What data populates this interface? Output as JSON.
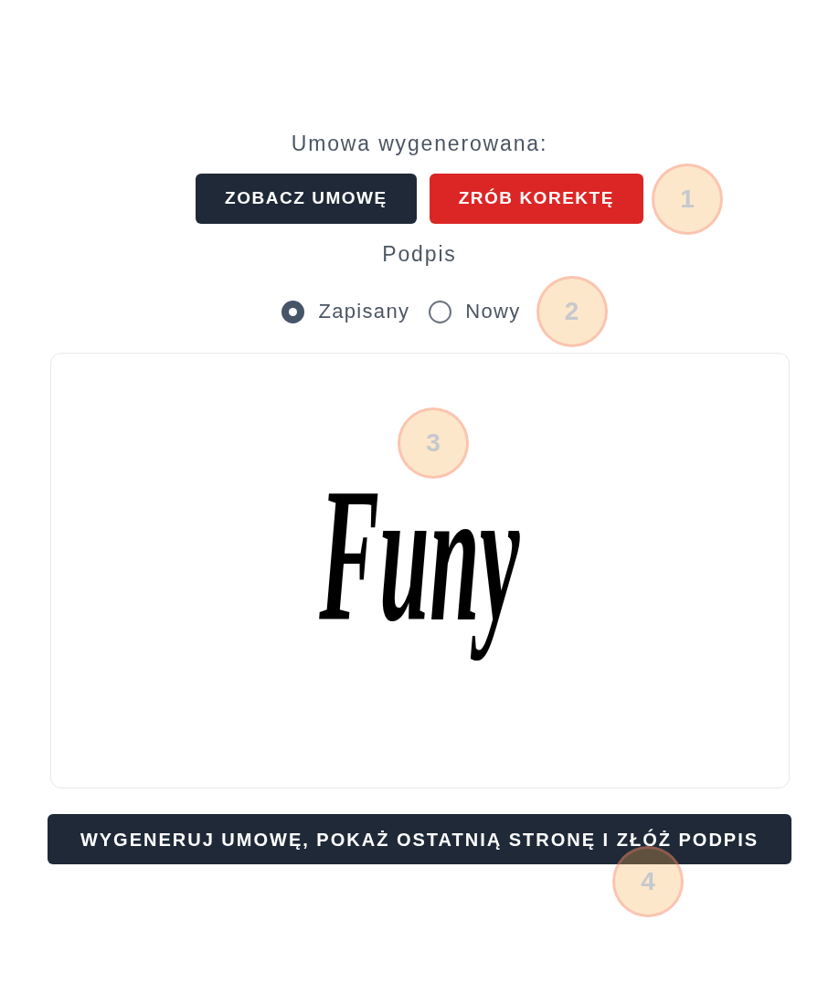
{
  "contract": {
    "title": "Umowa wygenerowana:",
    "buttons": [
      {
        "label": "ZOBACZ UMOWĘ",
        "kind": "primary"
      },
      {
        "label": "ZRÓB KOREKTĘ",
        "kind": "danger"
      }
    ],
    "marker": "1"
  },
  "signature_source": {
    "title": "Podpis",
    "options": [
      {
        "label": "Zapisany",
        "selected": true
      },
      {
        "label": "Nowy",
        "selected": false
      }
    ],
    "marker": "2"
  },
  "signature": {
    "text": "Funy",
    "marker": "3"
  },
  "submit": {
    "label": "WYGENERUJ UMOWĘ, POKAŻ OSTATNIĄ STRONĘ I ZŁÓŻ PODPIS",
    "marker": "4"
  }
}
